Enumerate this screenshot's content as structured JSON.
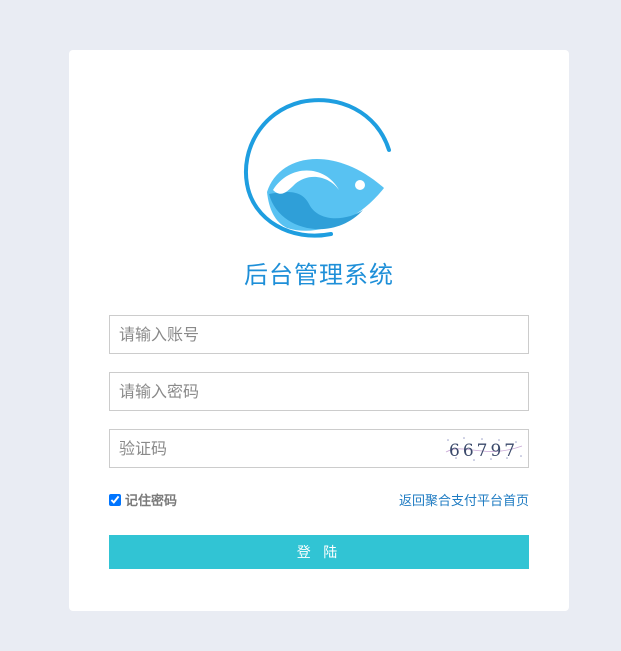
{
  "app": {
    "title": "后台管理系统"
  },
  "form": {
    "account_placeholder": "请输入账号",
    "password_placeholder": "请输入密码",
    "captcha_placeholder": "验证码",
    "captcha_code": "66797",
    "remember_label": "记住密码",
    "remember_checked": true,
    "back_link": "返回聚合支付平台首页",
    "login_label": "登 陆"
  },
  "colors": {
    "background": "#e9ecf3",
    "accent": "#31c4d4",
    "logo_blue": "#1e8fd8",
    "link": "#1e7bc2"
  }
}
